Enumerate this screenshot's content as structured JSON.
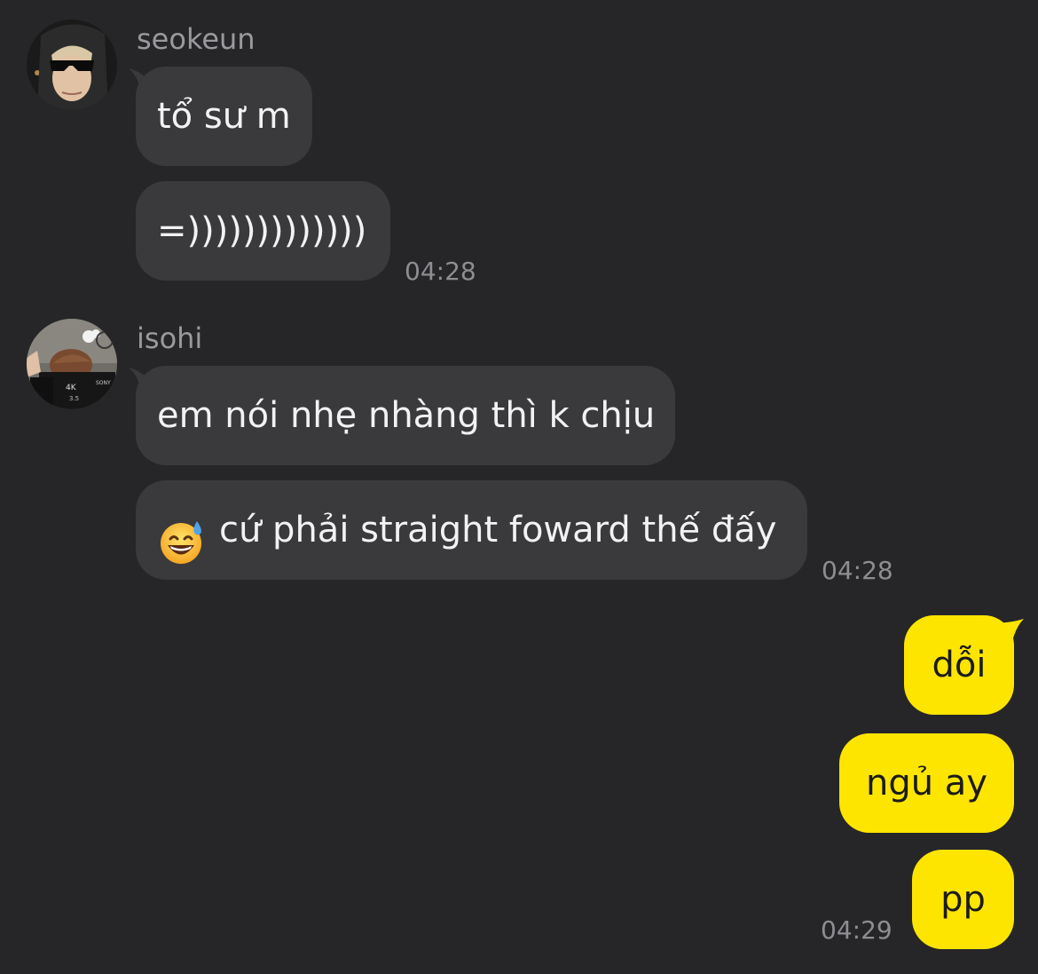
{
  "messages": {
    "group1": {
      "sender": "seokeun",
      "avatar_icon": "avatar-sunglasses-photo",
      "bubbles": [
        "tổ sư m",
        "=)))))))))))))"
      ],
      "time": "04:28"
    },
    "group2": {
      "sender": "isohi",
      "avatar_icon": "avatar-camera-photo",
      "bubbles": [
        "em nói nhẹ nhàng thì k chịu",
        "cứ phải straight foward thế đấy"
      ],
      "emoji_icon": "grinning-sweat-emoji",
      "time": "04:28"
    },
    "mine": {
      "bubbles": [
        "dỗi",
        "ngủ ay",
        "pp"
      ],
      "time": "04:29"
    }
  },
  "colors": {
    "background": "#262628",
    "incoming_bubble": "#3a3a3c",
    "outgoing_bubble": "#fee500",
    "meta_text": "#9a9a9e"
  }
}
